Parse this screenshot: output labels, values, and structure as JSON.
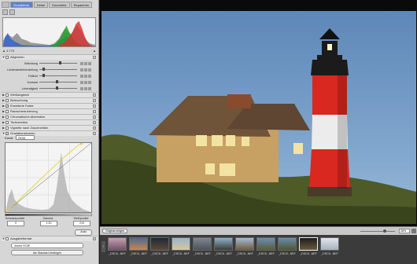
{
  "sidebar": {
    "tabs": [
      "Grundeinst.",
      "Detail",
      "Geometrie",
      "Reparieren"
    ],
    "active_tab": 0,
    "info": {
      "left": "▲ 3.775",
      "right": "▲"
    },
    "general_section": "Allgemein",
    "sliders": [
      {
        "label": "Belichtung",
        "pos": 0.55
      },
      {
        "label": "Lichterwiederherstellung",
        "pos": 0.08
      },
      {
        "label": "Fülllicht",
        "pos": 0.08
      },
      {
        "label": "Kontrast",
        "pos": 0.45
      },
      {
        "label": "Lebendigkeit",
        "pos": 0.45
      },
      {
        "label": "Klarheit",
        "pos": 0.45
      }
    ],
    "sections": [
      {
        "label": "Weißabgleich",
        "checked": false
      },
      {
        "label": "Beleuchtung",
        "checked": false
      },
      {
        "label": "Erweiterte Farbe",
        "checked": true
      },
      {
        "label": "Rauschreduzierung",
        "checked": false
      },
      {
        "label": "Chromatische Aberration",
        "checked": false
      },
      {
        "label": "Tonkorrektur",
        "checked": false
      },
      {
        "label": "Vignette nach Zuschneiden",
        "checked": false
      },
      {
        "label": "Gradationskurven",
        "checked": true
      }
    ],
    "curves": {
      "channel_label": "Kanal:",
      "channel_value": "RGB",
      "black_label": "Schwarzpunkte",
      "black_value": "0",
      "gamma_label": "Gamma",
      "gamma_value": "1,00",
      "white_label": "Weißpunkte",
      "white_value": "219",
      "auto_label": "Auto"
    },
    "output_section": "Ausgabeformat",
    "output_value": "Adobe RGB¹",
    "standard_button": "Als Standard festlegen"
  },
  "viewer": {
    "original_button": "Original zeigen",
    "zoom_value": "28%",
    "zoom_fraction": 0.72
  },
  "filmstrip": {
    "thumbs": [
      {
        "caption": "_DSC6...NEF",
        "kind": "pink"
      },
      {
        "caption": "_DSC6...NEF",
        "kind": "sunset"
      },
      {
        "caption": "_DSC6...NEF",
        "kind": "dark"
      },
      {
        "caption": "_DSC6...NEF",
        "kind": "beach"
      },
      {
        "caption": "_DSC6...NEF",
        "kind": "grey"
      },
      {
        "caption": "_DSC6...NEF",
        "kind": "pier"
      },
      {
        "caption": "_DSC6...NEF",
        "kind": "houses"
      },
      {
        "caption": "_DSC6...NEF",
        "kind": "lighthouse"
      },
      {
        "caption": "_DSC6...NEF",
        "kind": "lighthouse2"
      },
      {
        "caption": "_DSC6...NEF",
        "kind": "selected"
      },
      {
        "caption": "_DSC6...NEF",
        "kind": "tower"
      }
    ],
    "selected_index": 9
  },
  "colors": {
    "tab_active": "#5a84c8",
    "sky": "#6f95bd",
    "lighthouse_red": "#d8281f"
  }
}
